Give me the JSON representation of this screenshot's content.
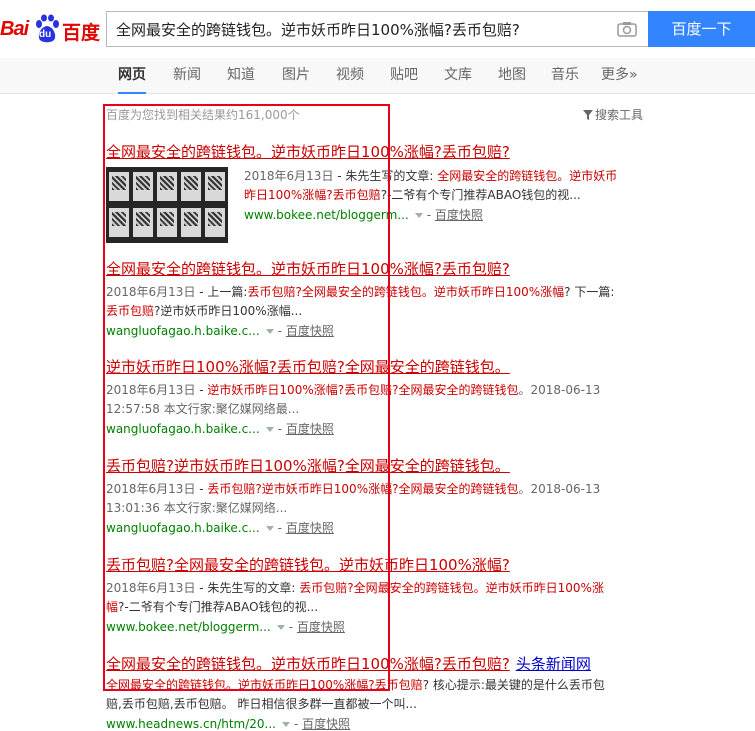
{
  "logo": {
    "bai": "Bai",
    "du": "du",
    "zh": "百度"
  },
  "search": {
    "query": "全网最安全的跨链钱包。逆市妖币昨日100%涨幅?丢币包赔?",
    "button_label": "百度一下"
  },
  "nav": {
    "tabs": [
      {
        "label": "网页",
        "active": true
      },
      {
        "label": "新闻",
        "active": false
      },
      {
        "label": "知道",
        "active": false
      },
      {
        "label": "图片",
        "active": false
      },
      {
        "label": "视频",
        "active": false
      },
      {
        "label": "贴吧",
        "active": false
      },
      {
        "label": "文库",
        "active": false
      },
      {
        "label": "地图",
        "active": false
      },
      {
        "label": "音乐",
        "active": false
      },
      {
        "label": "更多»",
        "active": false
      }
    ]
  },
  "stats": "百度为您找到相关结果约161,000个",
  "tools_label": "搜索工具",
  "snapshot_label": "百度快照",
  "results": [
    {
      "title": "全网最安全的跨链钱包。逆市妖币昨日100%涨幅?丢币包赔?",
      "abstract_line1_date": "2018年6月13日",
      "abstract_line1_text": " - 朱先生写的文章: ",
      "abstract_line1_em": "全网最安全的跨链钱包。逆市妖币",
      "abstract_line2_em": "昨日100%涨幅?丢币包赔",
      "abstract_line2_text": "?-二爷有个专门推荐ABAO钱包的视...",
      "url": "www.bokee.net/bloggerm..."
    },
    {
      "title": "全网最安全的跨链钱包。逆市妖币昨日100%涨幅?丢币包赔?",
      "abstract_line1_date": "2018年6月13日",
      "abstract_line1_text": " - 上一篇:",
      "abstract_line1_em": "丢币包赔?全网最安全的跨链钱包。逆市妖币昨日100%涨幅",
      "abstract_line1_tail": "? 下一篇:",
      "abstract_line2_em": "丢币包赔",
      "abstract_line2_text": "?逆市妖币昨日100%涨幅...",
      "url": "wangluofagao.h.baike.c..."
    },
    {
      "title": "逆市妖币昨日100%涨幅?丢币包赔?全网最安全的跨链钱包。",
      "abstract_line1_date": "2018年6月13日",
      "abstract_line1_text": " - ",
      "abstract_line1_em": "逆市妖币昨日100%涨幅?丢币包赔?全网最安全的跨链钱包",
      "abstract_line1_tail": "。2018-06-13",
      "abstract_line2_text": "12:57:58 本文行家:聚亿媒网络最...",
      "url": "wangluofagao.h.baike.c..."
    },
    {
      "title": "丢币包赔?逆市妖币昨日100%涨幅?全网最安全的跨链钱包。",
      "abstract_line1_date": "2018年6月13日",
      "abstract_line1_text": " - ",
      "abstract_line1_em": "丢币包赔?逆市妖币昨日100%涨幅?全网最安全的跨链钱包",
      "abstract_line1_tail": "。2018-06-13",
      "abstract_line2_text": "13:01:36 本文行家:聚亿媒网络...",
      "url": "wangluofagao.h.baike.c..."
    },
    {
      "title": "丢币包赔?全网最安全的跨链钱包。逆市妖币昨日100%涨幅?",
      "abstract_line1_date": "2018年6月13日",
      "abstract_line1_text": " - 朱先生写的文章: ",
      "abstract_line1_em": "丢币包赔?全网最安全的跨链钱包。逆市妖币昨日100%涨",
      "abstract_line2_em": "幅",
      "abstract_line2_text": "?-二爷有个专门推荐ABAO钱包的视...",
      "url": "www.bokee.net/bloggerm..."
    },
    {
      "title": "全网最安全的跨链钱包。逆市妖币昨日100%涨幅?丢币包赔?",
      "source": "头条新闻网",
      "abstract_line1_em": "全网最安全的跨链钱包。逆市妖币昨日100%涨幅?丢币包赔",
      "abstract_line1_text": "? 核心提示:最关键的是什么丢币包",
      "abstract_line2_text": "赔,丢币包赔,丢币包赔。 昨日相信很多群一直都被一个叫...",
      "url": "www.headnews.cn/htm/20..."
    }
  ],
  "colors": {
    "brand_red": "#e10601",
    "brand_blue": "#2932e1",
    "button": "#3385ff",
    "title_red": "#cc0000",
    "url_green": "#008000",
    "highlight_box": "#e6001c"
  }
}
